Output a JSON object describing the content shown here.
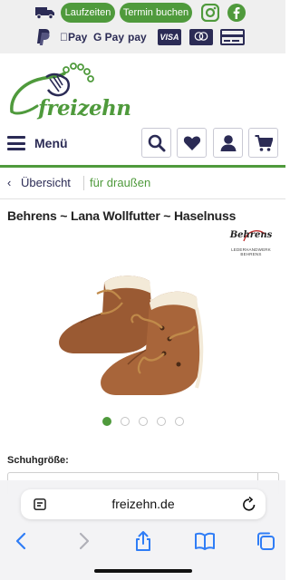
{
  "topbar": {
    "buttons": [
      "Laufzeiten",
      "Termin buchen"
    ],
    "icons": [
      "truck-icon",
      "instagram-icon",
      "facebook-icon"
    ],
    "payments": {
      "apple_pay": "Pay",
      "google_pay": "G Pay",
      "amazon_pay": "pay",
      "visa": "VISA"
    }
  },
  "logo": {
    "text": "freizehn"
  },
  "nav": {
    "menu_label": "Menü",
    "icons": [
      "search-icon",
      "heart-icon",
      "user-icon",
      "cart-icon"
    ]
  },
  "breadcrumb": {
    "back": "Übersicht",
    "category": "für draußen"
  },
  "product": {
    "title": "Behrens ~ Lana Wollfutter ~ Haselnuss",
    "brand_name": "Behrens",
    "brand_sub": "LEDERHANDWERK BEHRENS",
    "image_count": 5,
    "active_image": 1
  },
  "options": {
    "size_label": "Schuhgröße:"
  },
  "browser": {
    "url": "freizehn.de"
  },
  "colors": {
    "brand_green": "#4f9a3c",
    "brand_navy": "#2b2b55"
  }
}
